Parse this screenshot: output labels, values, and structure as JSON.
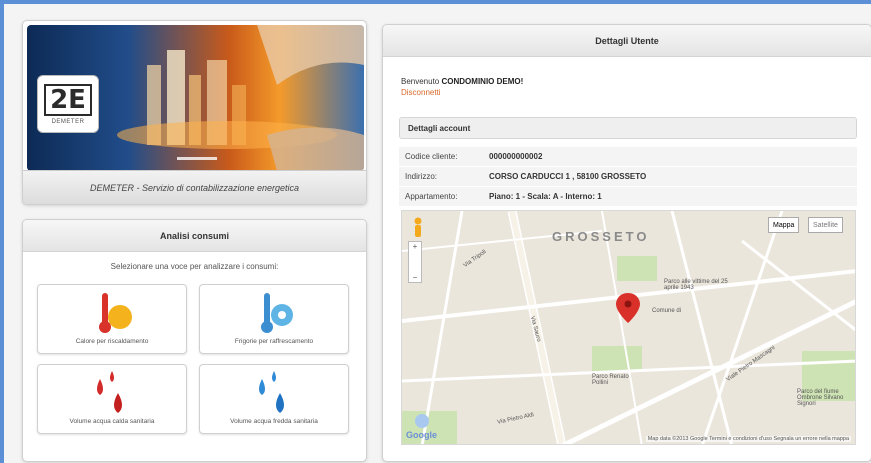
{
  "banner": {
    "logo_glyph": "2E",
    "logo_text": "DEMETER",
    "caption": "DEMETER - Servizio di contabilizzazione energetica"
  },
  "analisi": {
    "title": "Analisi consumi",
    "subtitle": "Selezionare una voce per analizzare i consumi:",
    "tiles": [
      {
        "label": "Calore per riscaldamento",
        "icon": "thermometer-sun-icon"
      },
      {
        "label": "Frigorie per raffrescamento",
        "icon": "thermometer-snowflake-icon"
      },
      {
        "label": "Volume acqua calda sanitaria",
        "icon": "red-droplets-icon"
      },
      {
        "label": "Volume acqua fredda sanitaria",
        "icon": "blue-droplets-icon"
      }
    ]
  },
  "utente": {
    "title": "Dettagli Utente",
    "welcome_prefix": "Benvenuto",
    "welcome_name": "CONDOMINIO DEMO!",
    "logout": "Disconnetti",
    "account_title": "Dettagli account",
    "rows": [
      {
        "key": "Codice cliente:",
        "value": "000000000002"
      },
      {
        "key": "Indirizzo:",
        "value": "CORSO CARDUCCI 1 , 58100 GROSSETO"
      },
      {
        "key": "Appartamento:",
        "value": "Piano: 1 - Scala: A - Interno: 1"
      }
    ]
  },
  "map": {
    "type_map": "Mappa",
    "type_satellite": "Satellite",
    "city": "GROSSETO",
    "labels": {
      "park1": "Parco alle vittime del 25 aprile 1943",
      "comune": "Comune di",
      "park2": "Parco Renato Pollini",
      "park3": "Parco del fiume Ombrone Silvano Signori",
      "street1": "Via Tripoli",
      "street2": "Via Sauro",
      "street3": "Viale Pietro Mascagni",
      "street4": "Via Pietro Aldi"
    },
    "google": "Google",
    "footer": "Map data ©2013 Google  Termini e condizioni d'uso  Segnala un errore nella mappa"
  },
  "colors": {
    "accent_border": "#5b8fd6",
    "logout": "#d9692b",
    "pin": "#d9302a"
  }
}
